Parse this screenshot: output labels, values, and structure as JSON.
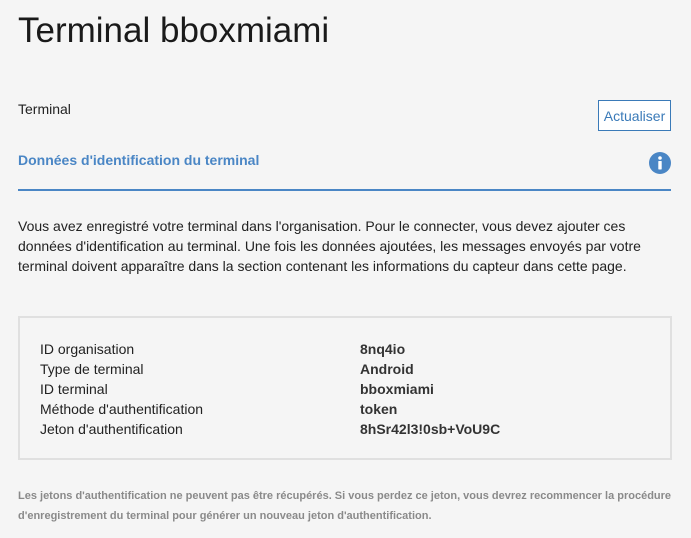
{
  "header": {
    "title": "Terminal bboxmiami"
  },
  "section": {
    "label": "Terminal",
    "refresh_label": "Actualiser"
  },
  "panel": {
    "heading": "Données d'identification du terminal",
    "info_icon": "info-icon",
    "accent_color": "#4a86c5"
  },
  "description": "Vous avez enregistré votre terminal dans l'organisation. Pour le connecter, vous devez ajouter ces données d'identification au terminal. Une fois les données ajoutées, les messages envoyés par votre terminal doivent apparaître dans la section contenant les informations du capteur dans cette page.",
  "credentials": [
    {
      "label": "ID organisation",
      "value": "8nq4io"
    },
    {
      "label": "Type de terminal",
      "value": "Android"
    },
    {
      "label": "ID terminal",
      "value": "bboxmiami"
    },
    {
      "label": "Méthode d'authentification",
      "value": "token"
    },
    {
      "label": "Jeton d'authentification",
      "value": "8hSr42l3!0sb+VoU9C"
    }
  ],
  "footnote": "Les jetons d'authentification ne peuvent pas être récupérés. Si vous perdez ce jeton, vous devrez recommencer la procédure d'enregistrement du terminal pour générer un nouveau jeton d'authentification."
}
